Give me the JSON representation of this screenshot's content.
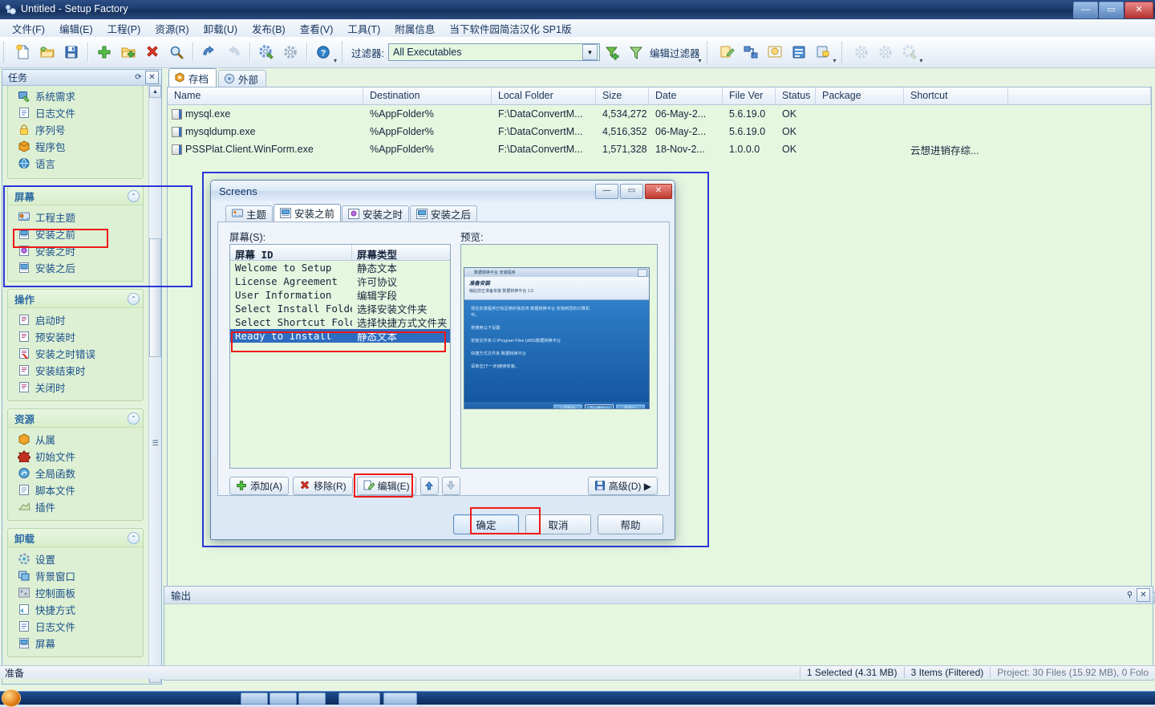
{
  "window": {
    "title": "Untitled - Setup Factory",
    "minimize": "—",
    "maximize": "▭",
    "close": "✕"
  },
  "menu": [
    "文件(F)",
    "编辑(E)",
    "工程(P)",
    "资源(R)",
    "卸载(U)",
    "发布(B)",
    "查看(V)",
    "工具(T)",
    "附属信息",
    "当下软件园简洁汉化 SP1版"
  ],
  "toolbar": {
    "filter_label": "过滤器:",
    "filter_value": "All Executables",
    "edit_filter_label": "编辑过滤器",
    "dropdown_caret": "▼",
    "icons": [
      "new-file-icon",
      "open-folder-icon",
      "save-icon",
      "add-files-icon",
      "add-folder-icon",
      "delete-icon",
      "search-icon",
      "undo-icon",
      "redo-icon",
      "build-settings-icon",
      "settings-icon",
      "help-icon"
    ]
  },
  "taskpane": {
    "title": "任务",
    "refresh_icon": "⟳",
    "close_icon": "✕",
    "top_items": [
      {
        "label": "系统需求",
        "icon": "system-requirements-icon"
      },
      {
        "label": "日志文件",
        "icon": "log-file-icon"
      },
      {
        "label": "序列号",
        "icon": "serial-number-icon"
      },
      {
        "label": "程序包",
        "icon": "package-icon"
      },
      {
        "label": "语言",
        "icon": "language-globe-icon"
      }
    ],
    "groups": [
      {
        "title": "屏幕",
        "collapse_icon": "⌃",
        "highlighted": true,
        "items": [
          {
            "label": "工程主题",
            "icon": "project-theme-icon",
            "selected": false
          },
          {
            "label": "安装之前",
            "icon": "screen-before-icon",
            "selected": true
          },
          {
            "label": "安装之时",
            "icon": "screen-during-icon",
            "selected": false
          },
          {
            "label": "安装之后",
            "icon": "screen-after-icon",
            "selected": false
          }
        ]
      },
      {
        "title": "操作",
        "collapse_icon": "⌃",
        "highlighted": false,
        "items": [
          {
            "label": "启动时",
            "icon": "action-startup-icon",
            "selected": false
          },
          {
            "label": "预安装时",
            "icon": "action-preinstall-icon",
            "selected": false
          },
          {
            "label": "安装之时错误",
            "icon": "action-error-icon",
            "selected": false
          },
          {
            "label": "安装结束时",
            "icon": "action-finish-icon",
            "selected": false
          },
          {
            "label": "关闭时",
            "icon": "action-shutdown-icon",
            "selected": false
          }
        ]
      },
      {
        "title": "资源",
        "collapse_icon": "⌃",
        "highlighted": false,
        "items": [
          {
            "label": "从属",
            "icon": "dependency-icon",
            "selected": false
          },
          {
            "label": "初始文件",
            "icon": "primer-file-icon",
            "selected": false
          },
          {
            "label": "全局函数",
            "icon": "global-functions-icon",
            "selected": false
          },
          {
            "label": "脚本文件",
            "icon": "script-file-icon",
            "selected": false
          },
          {
            "label": "插件",
            "icon": "plugin-icon",
            "selected": false
          }
        ]
      },
      {
        "title": "卸载",
        "collapse_icon": "⌃",
        "highlighted": false,
        "items": [
          {
            "label": "设置",
            "icon": "uninstall-settings-icon",
            "selected": false
          },
          {
            "label": "背景窗口",
            "icon": "background-window-icon",
            "selected": false
          },
          {
            "label": "控制面板",
            "icon": "control-panel-icon",
            "selected": false
          },
          {
            "label": "快捷方式",
            "icon": "shortcut-icon",
            "selected": false
          },
          {
            "label": "日志文件",
            "icon": "log-file-icon",
            "selected": false
          },
          {
            "label": "屏幕",
            "icon": "screens-icon",
            "selected": false
          }
        ]
      }
    ]
  },
  "doc": {
    "tabs": [
      {
        "label": "存档",
        "icon": "archive-icon",
        "active": true
      },
      {
        "label": "外部",
        "icon": "external-icon",
        "active": false
      }
    ],
    "columns": [
      "Name",
      "Destination",
      "Local Folder",
      "Size",
      "Date",
      "File Ver",
      "Status",
      "Package",
      "Shortcut"
    ],
    "rows": [
      {
        "name": "mysql.exe",
        "destination": "%AppFolder%",
        "local_folder": "F:\\DataConvertM...",
        "size": "4,534,272",
        "date": "06-May-2...",
        "file_ver": "5.6.19.0",
        "status": "OK",
        "package": "",
        "shortcut": ""
      },
      {
        "name": "mysqldump.exe",
        "destination": "%AppFolder%",
        "local_folder": "F:\\DataConvertM...",
        "size": "4,516,352",
        "date": "06-May-2...",
        "file_ver": "5.6.19.0",
        "status": "OK",
        "package": "",
        "shortcut": ""
      },
      {
        "name": "PSSPlat.Client.WinForm.exe",
        "destination": "%AppFolder%",
        "local_folder": "F:\\DataConvertM...",
        "size": "1,571,328",
        "date": "18-Nov-2...",
        "file_ver": "1.0.0.0",
        "status": "OK",
        "package": "",
        "shortcut": "云想进销存综..."
      }
    ]
  },
  "output": {
    "title": "输出",
    "pin_icon": "⚲",
    "close_icon": "✕"
  },
  "statusbar": {
    "left": "准备",
    "selected": "1 Selected (4.31 MB)",
    "items": "3 Items (Filtered)",
    "project": "Project: 30 Files (15.92 MB), 0 Folo"
  },
  "dialog": {
    "title": "Screens",
    "minimize": "—",
    "maximize": "▭",
    "close": "✕",
    "tabs": [
      {
        "label": "主题",
        "icon": "theme-icon",
        "active": false
      },
      {
        "label": "安装之前",
        "icon": "screen-before-icon",
        "active": true
      },
      {
        "label": "安装之时",
        "icon": "screen-during-icon",
        "active": false
      },
      {
        "label": "安装之后",
        "icon": "screen-after-icon",
        "active": false
      }
    ],
    "screens_label": "屏幕(S):",
    "preview_label": "预览:",
    "list_columns": [
      "屏幕 ID",
      "屏幕类型"
    ],
    "list_rows": [
      {
        "id": "Welcome to Setup",
        "type": "静态文本",
        "selected": false
      },
      {
        "id": "License Agreement",
        "type": "许可协议",
        "selected": false
      },
      {
        "id": "User Information",
        "type": "编辑字段",
        "selected": false
      },
      {
        "id": "Select Install Folder",
        "type": "选择安装文件夹",
        "selected": false
      },
      {
        "id": "Select Shortcut Folder",
        "type": "选择快捷方式文件夹",
        "selected": false
      },
      {
        "id": "Ready to Install",
        "type": "静态文本",
        "selected": true
      }
    ],
    "buttons": {
      "add": "添加(A)",
      "remove": "移除(R)",
      "edit": "编辑(E)",
      "move_up": "▲",
      "move_down": "▼",
      "advanced": "高级(D) ▶",
      "ok": "确定",
      "cancel": "取消",
      "help": "帮助"
    },
    "preview_window": {
      "caption": "数据转换平台 安装程序",
      "heading": "准备安装",
      "subheading": "稍后您正准备安装 数据转换平台 1.0",
      "lines": [
        "现在安装程序已有足够的信息将 数据转换平台 安装到您的计算机",
        "中。",
        "",
        "将使用以下设置:",
        "",
        "安装文件夹        C:\\Program Files (x86)\\数据转换平台",
        "",
        "快捷方式文件夹    数据转换平台",
        "",
        "请单击[下一步]继续安装。"
      ],
      "buttons": [
        {
          "label": "< 返回(B)",
          "focus": false
        },
        {
          "label": "下一步(N) >",
          "focus": true
        },
        {
          "label": "取消(C)",
          "focus": false
        }
      ]
    }
  },
  "colors": {
    "accent_blue": "#2d6cc0",
    "highlight_red": "#f01818",
    "highlight_blue": "#2a35d8",
    "pane_green": "#e6f7e0"
  }
}
